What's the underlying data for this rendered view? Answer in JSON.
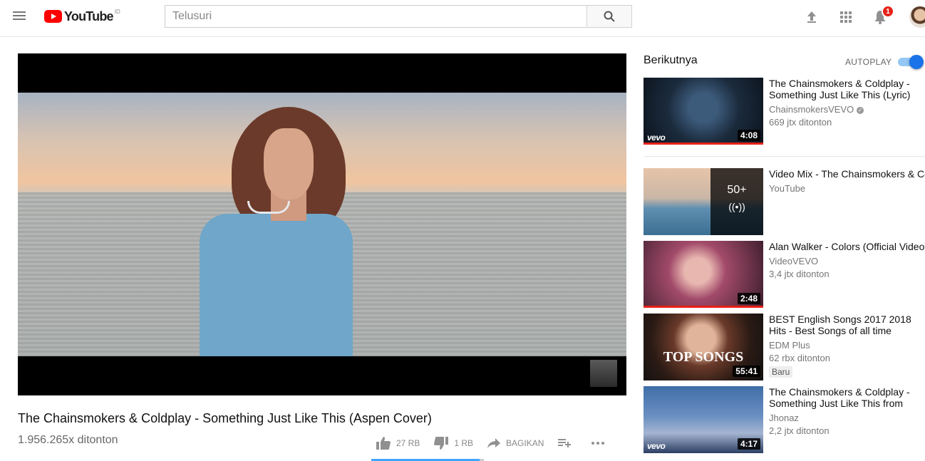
{
  "masthead": {
    "logo_text": "YouTube",
    "country_code": "ID",
    "search_placeholder": "Telusuri",
    "notification_count": "1",
    "icons": [
      "menu-icon",
      "upload-icon",
      "apps-icon",
      "bell-icon"
    ]
  },
  "video": {
    "title": "The Chainsmokers & Coldplay - Something Just Like This (Aspen Cover)",
    "views": "1.956.265x ditonton",
    "likes": "27 RB",
    "dislikes": "1 RB",
    "share_label": "BAGIKAN",
    "like_ratio": 0.96
  },
  "sidebar": {
    "up_next_label": "Berikutnya",
    "autoplay_label": "AUTOPLAY",
    "autoplay_on": true,
    "items": [
      {
        "title": "The Chainsmokers & Coldplay - Something Just Like This (Lyric)",
        "channel": "ChainsmokersVEVO",
        "views": "669 jtx ditonton",
        "duration": "4:08",
        "vevo": "vevo"
      },
      {
        "title": "Video Mix - The Chainsmokers & Coldplay - Something Just Like This",
        "channel": "YouTube",
        "mix_count": "50+"
      },
      {
        "title": "Alan Walker - Colors (Official Video)",
        "channel": "VideoVEVO",
        "views": "3,4 jtx ditonton",
        "duration": "2:48"
      },
      {
        "title": "BEST English Songs 2017 2018 Hits - Best Songs of all time",
        "channel": "EDM Plus",
        "views": "62 rbx ditonton",
        "duration": "55:41",
        "badge": "Baru",
        "thumb_text": "TOP SONGS"
      },
      {
        "title": "The Chainsmokers & Coldplay - Something Just Like This from",
        "channel": "Jhonaz",
        "views": "2,2 jtx ditonton",
        "duration": "4:17",
        "vevo": "vevo"
      }
    ]
  },
  "colors": {
    "brand_red": "#ff0000",
    "accent_blue": "#3ea6ff",
    "badge_red": "#e62117"
  }
}
